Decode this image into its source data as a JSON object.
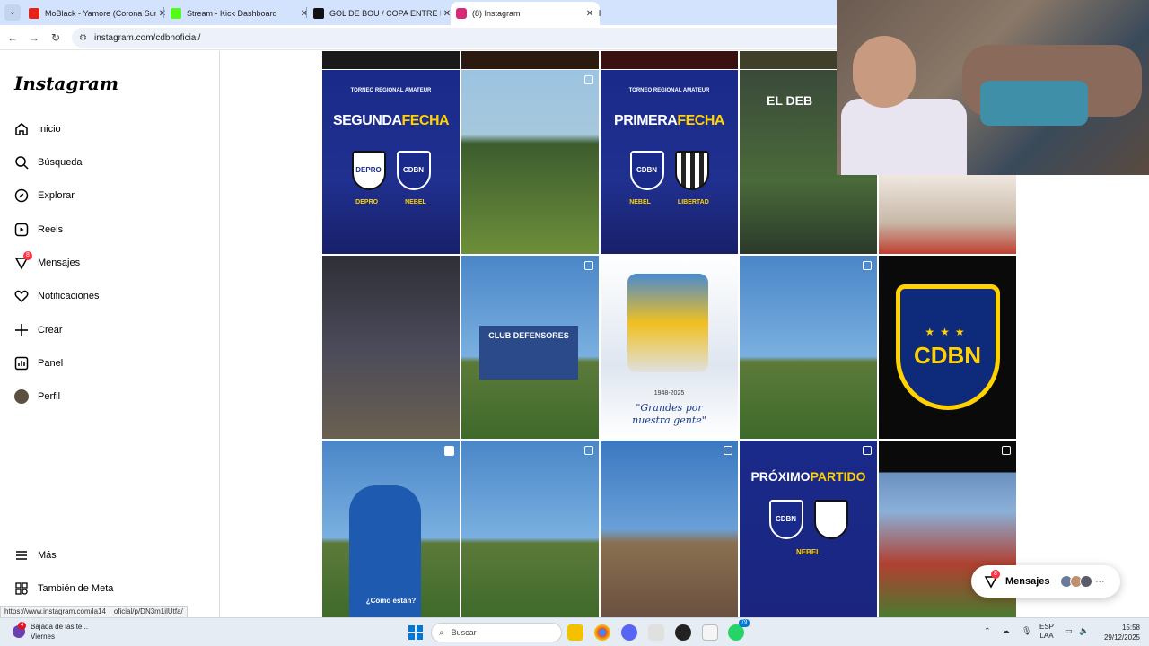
{
  "browser": {
    "tabs": [
      {
        "label": "MoBlack - Yamore (Corona Sun",
        "favicon_color": "#e62117",
        "active": false
      },
      {
        "label": "Stream - Kick Dashboard",
        "favicon_color": "#53fc18",
        "active": false
      },
      {
        "label": "GOL DE BOU / COPA ENTRE RÍ",
        "favicon_color": "#111111",
        "active": false
      },
      {
        "label": "(8) Instagram",
        "favicon_color": "#d62976",
        "active": true
      }
    ],
    "url": "instagram.com/cdbnoficial/",
    "status_url": "https://www.instagram.com/la14__oficial/p/DN3m1ilUtfa/"
  },
  "sidebar": {
    "logo": "Instagram",
    "items": [
      {
        "label": "Inicio",
        "icon": "home-icon"
      },
      {
        "label": "Búsqueda",
        "icon": "search-icon"
      },
      {
        "label": "Explorar",
        "icon": "compass-icon"
      },
      {
        "label": "Reels",
        "icon": "reels-icon"
      },
      {
        "label": "Mensajes",
        "icon": "messenger-icon",
        "badge": "8"
      },
      {
        "label": "Notificaciones",
        "icon": "heart-icon"
      },
      {
        "label": "Crear",
        "icon": "plus-icon"
      },
      {
        "label": "Panel",
        "icon": "chart-icon"
      },
      {
        "label": "Perfil",
        "icon": "avatar"
      }
    ],
    "bottom": [
      {
        "label": "Más",
        "icon": "menu-icon"
      },
      {
        "label": "También de Meta",
        "icon": "meta-icon"
      }
    ]
  },
  "posts": {
    "p1": {
      "top": "TORNEO REGIONAL AMATEUR",
      "big_a": "SEGUNDA",
      "big_b": "FECHA",
      "team_a": "DEPRO",
      "team_b": "NEBEL",
      "shield_a": "DEPRO",
      "shield_b": "CDBN"
    },
    "p3": {
      "top": "TORNEO REGIONAL AMATEUR",
      "big_a": "PRIMERA",
      "big_b": "FECHA",
      "team_a": "NEBEL",
      "team_b": "LIBERTAD",
      "shield_a": "CDBN",
      "shield_b": ""
    },
    "p4": {
      "banner": "EL DEB"
    },
    "p7": {
      "banner": "CLUB DEFENSORES"
    },
    "p8": {
      "years": "1948-2025",
      "text_a": "\"Grandes por",
      "text_b": "nuestra gente\""
    },
    "p10": {
      "stars": "★★★",
      "abbr": "CDBN"
    },
    "p11": {
      "caption": "¿Cómo están?"
    },
    "p14": {
      "title_a": "PRÓXIMO",
      "title_b": "PARTIDO",
      "shield_a": "CDBN",
      "team_a": "NEBEL"
    }
  },
  "messages_pill": {
    "label": "Mensajes",
    "badge": "8"
  },
  "taskbar": {
    "news_title": "Bajada de las te...",
    "news_sub": "Viernes",
    "news_badge": "4",
    "search_placeholder": "Buscar",
    "whatsapp_badge": "79",
    "lang_a": "ESP",
    "lang_b": "LAA",
    "time": "15:58",
    "date": "29/12/2025"
  }
}
